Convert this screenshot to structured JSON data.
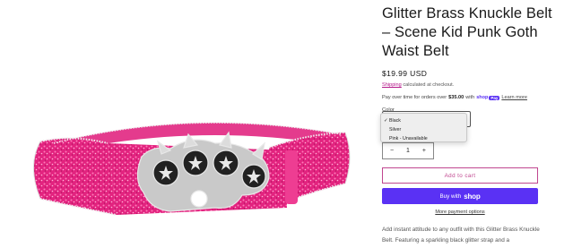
{
  "product": {
    "title": "Glitter Brass Knuckle Belt – Scene Kid Punk Goth Waist Belt",
    "price": "$19.99 USD",
    "shipping_link": "Shipping",
    "shipping_rest": " calculated at checkout.",
    "payover_prefix": "Pay over time for orders over ",
    "payover_amount": "$35.00",
    "payover_with": " with",
    "shop_word": "shop",
    "pay_word": "Pay",
    "learn_more": "Learn more",
    "description": "Add instant attitude to any outfit with this Glitter Brass Knuckle Belt. Featuring a sparkling black glitter strap and a"
  },
  "variant": {
    "label": "Color",
    "options": [
      {
        "label": "Black",
        "selected": true
      },
      {
        "label": "Silver",
        "selected": false
      },
      {
        "label": "Pink - Unavailable",
        "selected": false
      }
    ],
    "check_glyph": "✓"
  },
  "quantity": {
    "minus": "−",
    "value": "1",
    "plus": "+"
  },
  "buttons": {
    "add_to_cart": "Add to cart",
    "buy_with": "Buy with",
    "buy_shop_word": "shop",
    "more_payment": "More payment options"
  },
  "colors": {
    "accent": "#c0468f",
    "shop_purple": "#5a31f4",
    "belt_pink": "#e2237f"
  },
  "icons": {
    "checkmark": "check-icon"
  }
}
